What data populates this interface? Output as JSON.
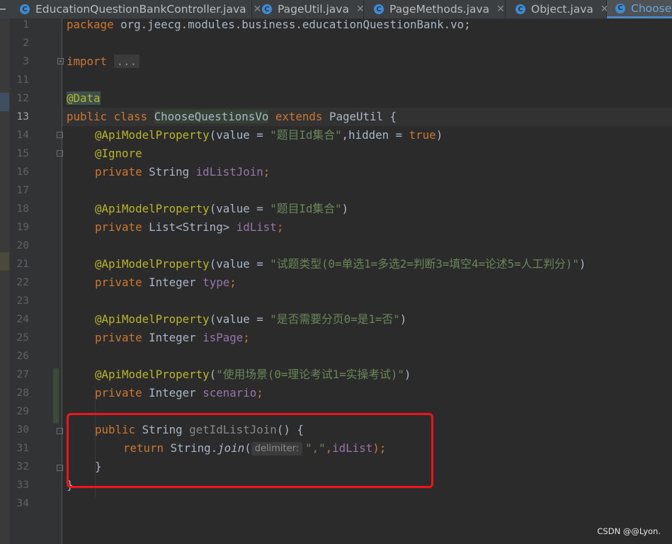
{
  "tabs": [
    {
      "label": "EducationQuestionBankController.java",
      "icon": "class-icon",
      "icon_letter": "C",
      "active": false
    },
    {
      "label": "PageUtil.java",
      "icon": "class-icon",
      "icon_letter": "C",
      "active": false
    },
    {
      "label": "PageMethods.java",
      "icon": "class-icon",
      "icon_letter": "C",
      "active": false
    },
    {
      "label": "Object.java",
      "icon": "class-icon",
      "icon_letter": "C",
      "active": false
    },
    {
      "label": "ChooseQ",
      "icon": "class-icon",
      "icon_letter": "C",
      "active": true
    }
  ],
  "close_glyph": "✕",
  "line_numbers": [
    "1",
    "2",
    "3",
    "11",
    "12",
    "13",
    "14",
    "15",
    "16",
    "17",
    "18",
    "19",
    "20",
    "21",
    "22",
    "23",
    "24",
    "25",
    "26",
    "27",
    "28",
    "29",
    "30",
    "31",
    "32",
    "33",
    "34"
  ],
  "current_line": "13",
  "code": {
    "l1": {
      "kw": "package",
      "rest": " org.jeecg.modules.business.educationQuestionBank.vo;"
    },
    "l3": {
      "kw": "import",
      "folded": "..."
    },
    "l12": {
      "ann": "@Data"
    },
    "l13": {
      "kw1": "public class",
      "cls": "ChooseQuestionsVo",
      "kw2": "extends",
      "rest": " PageUtil {"
    },
    "l14": {
      "ann": "@ApiModelProperty",
      "p1": "(value = ",
      "str": "\"题目Id集合\"",
      "p2": ",hidden = ",
      "kw": "true",
      "p3": ")"
    },
    "l15": {
      "ann": "@Ignore"
    },
    "l16": {
      "kw": "private",
      "type": " String ",
      "fld": "idListJoin",
      "end": ";"
    },
    "l18": {
      "ann": "@ApiModelProperty",
      "p1": "(value = ",
      "str": "\"题目Id集合\"",
      "p2": ")"
    },
    "l19": {
      "kw": "private",
      "type": " List<String> ",
      "fld": "idList",
      "end": ";"
    },
    "l21": {
      "ann": "@ApiModelProperty",
      "p1": "(value = ",
      "str": "\"试题类型(0=单选1=多选2=判断3=填空4=论述5=人工判分)\"",
      "p2": ")"
    },
    "l22": {
      "kw": "private",
      "type": " Integer ",
      "fld": "type",
      "end": ";"
    },
    "l24": {
      "ann": "@ApiModelProperty",
      "p1": "(value = ",
      "str": "\"是否需要分页0=是1=否\"",
      "p2": ")"
    },
    "l25": {
      "kw": "private",
      "type": " Integer ",
      "fld": "isPage",
      "end": ";"
    },
    "l27": {
      "ann": "@ApiModelProperty",
      "p1": "(",
      "str": "\"使用场景(0=理论考试1=实操考试)\"",
      "p2": ")"
    },
    "l28": {
      "kw": "private",
      "type": " Integer ",
      "fld": "scenario",
      "end": ";"
    },
    "l30": {
      "kw": "public",
      "type": " String ",
      "meth": "getIdListJoin",
      "rest": "() {"
    },
    "l31": {
      "kw": "return",
      "type": " String.",
      "call": "join",
      "open": "(",
      "hint": "delimiter:",
      "str": "\",\"",
      "rest": ",",
      "fld": "idList",
      "end": ");"
    },
    "l32": {
      "rest": "}"
    },
    "l33": {
      "rest": "}"
    }
  },
  "watermark": "CSDN @@Lyon.",
  "colors": {
    "highlight_box": "#f1141b",
    "keyword": "#cc7832",
    "annotation": "#bbb529",
    "string": "#6a8759",
    "field": "#9876aa"
  }
}
